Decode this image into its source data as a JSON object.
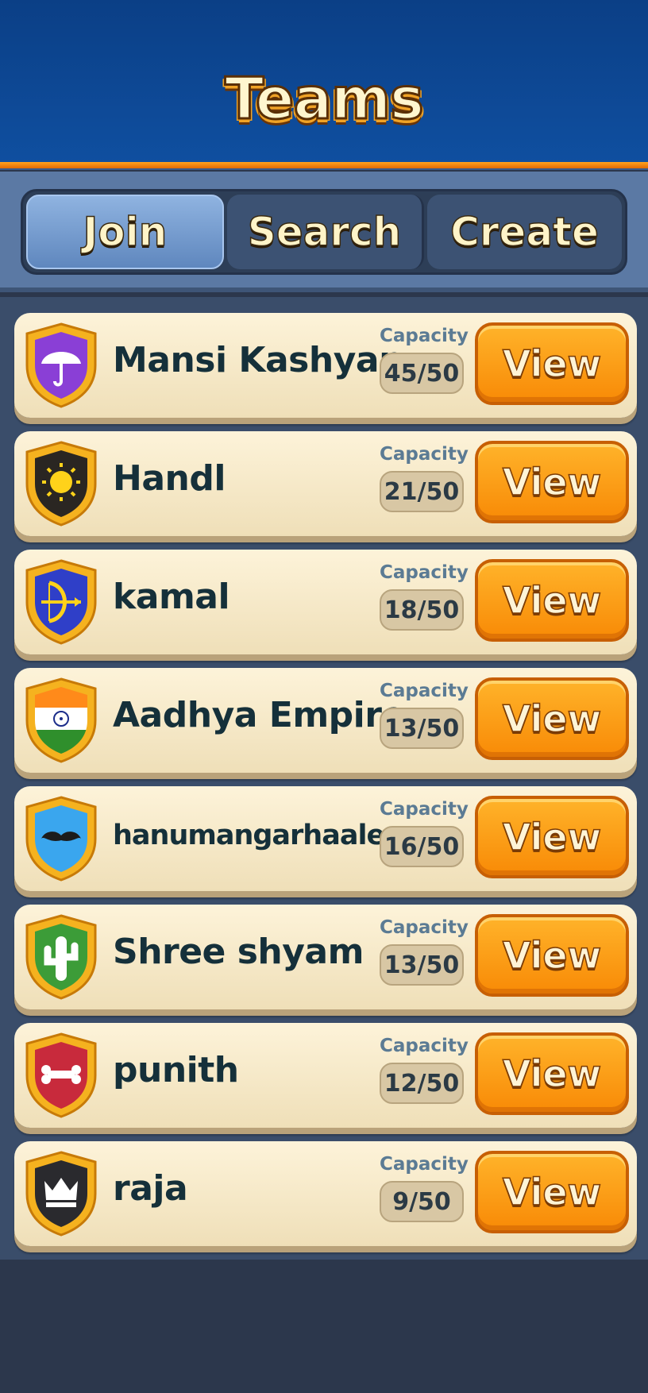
{
  "header": {
    "title": "Teams"
  },
  "tabs": [
    {
      "label": "Join",
      "active": true
    },
    {
      "label": "Search",
      "active": false
    },
    {
      "label": "Create",
      "active": false
    }
  ],
  "capacity_label": "Capacity",
  "view_label": "View",
  "teams": [
    {
      "name": "Mansi Kashyap",
      "capacity": "45/50",
      "icon": "umbrella-icon",
      "badge_color": "#8a3fd6"
    },
    {
      "name": "Handl",
      "capacity": "21/50",
      "icon": "sun-icon",
      "badge_color": "#2a2622"
    },
    {
      "name": "kamal",
      "capacity": "18/50",
      "icon": "bow-arrow-icon",
      "badge_color": "#2f3fc8"
    },
    {
      "name": "Aadhya Empire",
      "capacity": "13/50",
      "icon": "india-flag-icon",
      "badge_color": "#ff8a1a"
    },
    {
      "name": "hanumangarhaale",
      "capacity": "16/50",
      "icon": "mustache-icon",
      "badge_color": "#3aa6ee"
    },
    {
      "name": "Shree shyam",
      "capacity": "13/50",
      "icon": "cactus-icon",
      "badge_color": "#3c9c38"
    },
    {
      "name": "punith",
      "capacity": "12/50",
      "icon": "bone-icon",
      "badge_color": "#c82a3c"
    },
    {
      "name": "raja",
      "capacity": "9/50",
      "icon": "crown-icon",
      "badge_color": "#2a2a2e"
    }
  ]
}
